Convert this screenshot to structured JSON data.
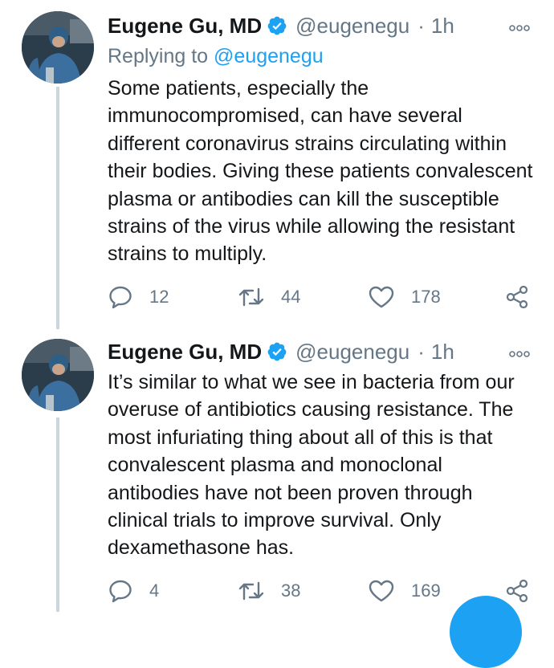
{
  "colors": {
    "accent": "#1da1f2",
    "secondary_text": "#657786",
    "thread_line": "#ccd6dd"
  },
  "tweets": [
    {
      "author_name": "Eugene Gu, MD",
      "handle": "@eugenegu",
      "separator": "·",
      "time": "1h",
      "more_icon": "more-icon",
      "replying_prefix": "Replying to",
      "replying_mention": "@eugenegu",
      "text": "Some patients, especially the immunocompromised, can have several different coronavirus strains circulating within their bodies. Giving these patients convalescent plasma or antibodies can kill the susceptible strains of the virus while allowing the resistant strains to multiply.",
      "replies": "12",
      "retweets": "44",
      "likes": "178"
    },
    {
      "author_name": "Eugene Gu, MD",
      "handle": "@eugenegu",
      "separator": "·",
      "time": "1h",
      "more_icon": "more-icon",
      "text": "It’s similar to what we see in bacteria from our overuse of antibiotics causing resistance. The most infuriating thing about all of this is that convalescent plasma and monoclonal antibodies have not been proven through clinical trials to improve survival. Only dexamethasone has.",
      "replies": "4",
      "retweets": "38",
      "likes": "169"
    }
  ]
}
